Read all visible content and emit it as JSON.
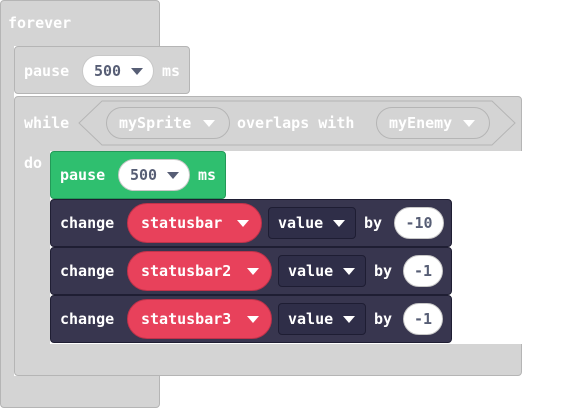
{
  "forever": {
    "label": "forever"
  },
  "pause_outer": {
    "label": "pause",
    "value": "500",
    "unit": "ms"
  },
  "while_block": {
    "label": "while",
    "do_label": "do",
    "condition": {
      "sprite": "mySprite",
      "op": "overlaps with",
      "target": "myEnemy"
    }
  },
  "pause_inner": {
    "label": "pause",
    "value": "500",
    "unit": "ms"
  },
  "changes": [
    {
      "label": "change",
      "bar": "statusbar",
      "prop": "value",
      "by": "by",
      "amount": "-10"
    },
    {
      "label": "change",
      "bar": "statusbar2",
      "prop": "value",
      "by": "by",
      "amount": "-1"
    },
    {
      "label": "change",
      "bar": "statusbar3",
      "prop": "value",
      "by": "by",
      "amount": "-1"
    }
  ],
  "colors": {
    "loops": "#d4d4d4",
    "statusbar": "#e8415b",
    "dark": "#38364f",
    "pause_green": "#2fbf6f"
  },
  "icons": [
    "dropdown-arrow-icon"
  ]
}
